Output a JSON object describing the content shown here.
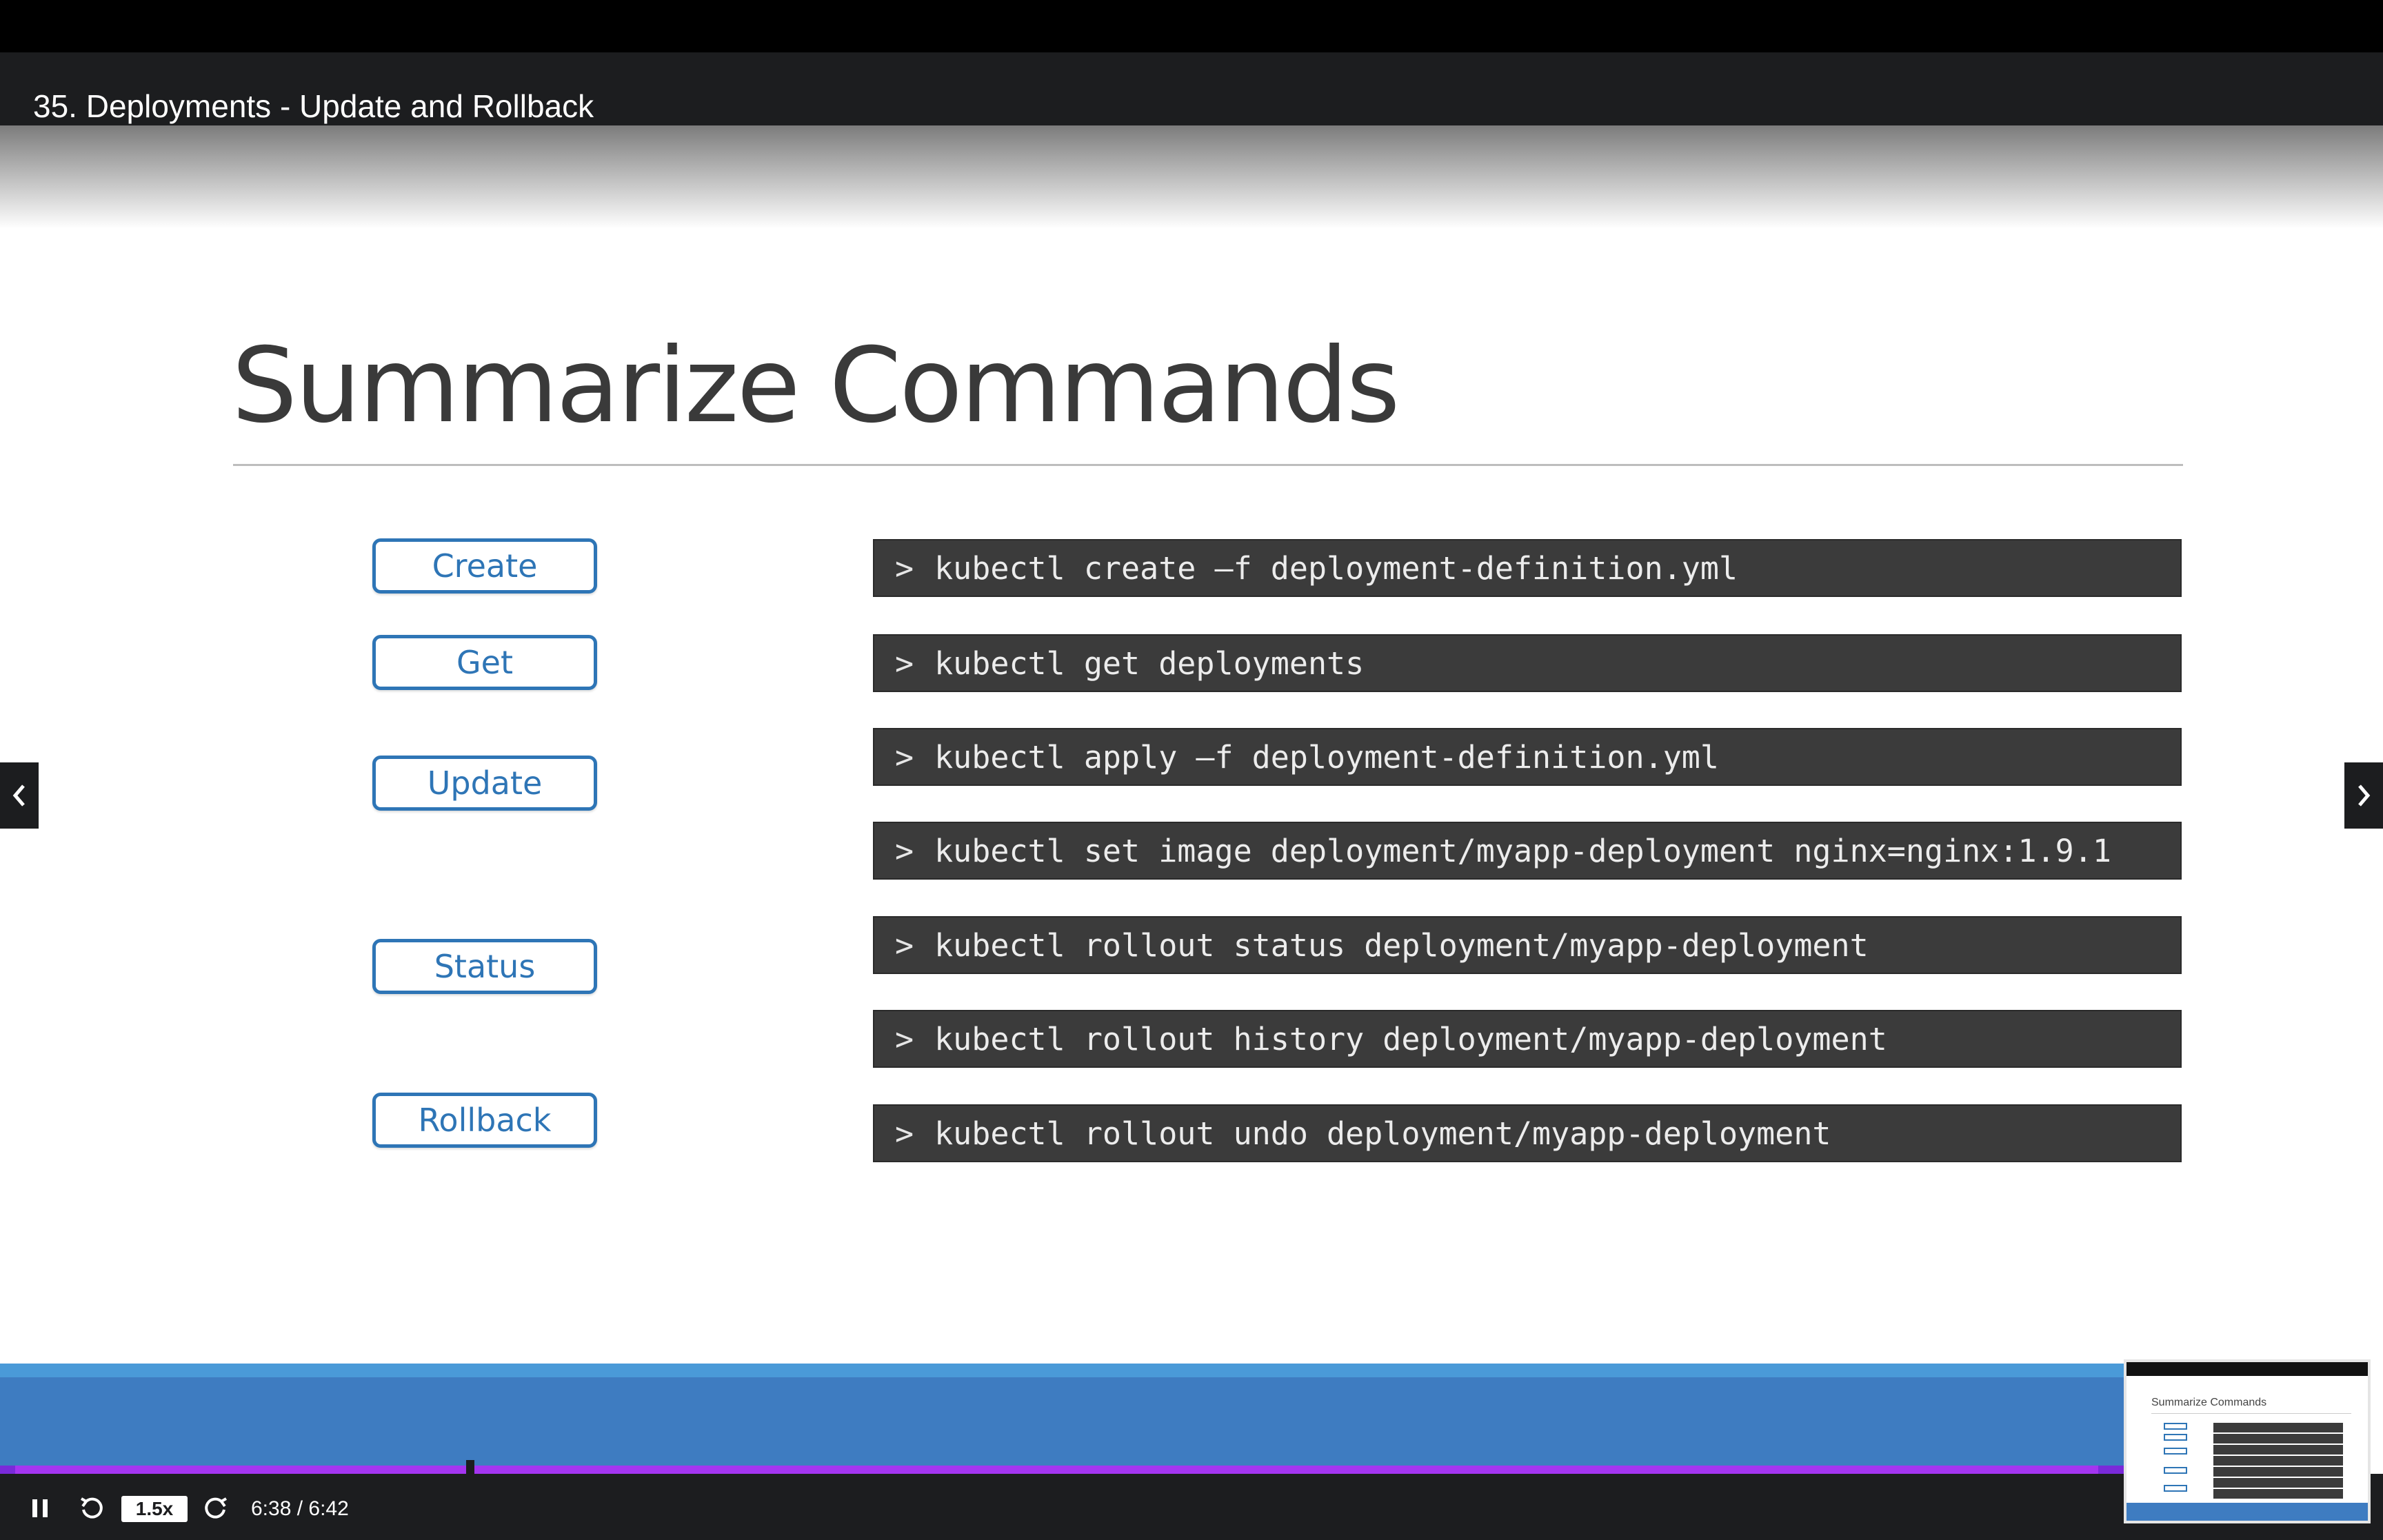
{
  "header": {
    "lecture_title": "35. Deployments - Update and Rollback"
  },
  "slide": {
    "title": "Summarize Commands",
    "labels": [
      "Create",
      "Get",
      "Update",
      "Status",
      "Rollback"
    ],
    "commands": [
      "kubectl create –f deployment-definition.yml",
      "kubectl get deployments",
      "kubectl apply –f deployment-definition.yml",
      "kubectl set image deployment/myapp-deployment nginx=nginx:1.9.1",
      "kubectl rollout status deployment/myapp-deployment",
      "kubectl rollout history deployment/myapp-deployment",
      "kubectl rollout undo deployment/myapp-deployment"
    ],
    "prompt_symbol": ">"
  },
  "navigation": {
    "prev_icon": "chevron-left-icon",
    "next_icon": "chevron-right-icon"
  },
  "player": {
    "speed": "1.5x",
    "time": "6:38 / 6:42",
    "progress_fraction": 0.988,
    "thumbnail_title": "Summarize Commands",
    "icons": {
      "pause": "pause-icon",
      "rewind": "rewind-icon",
      "forward": "forward-icon"
    },
    "colors": {
      "progress": "#a435f0",
      "accent_blue": "#3e7cc1"
    }
  }
}
